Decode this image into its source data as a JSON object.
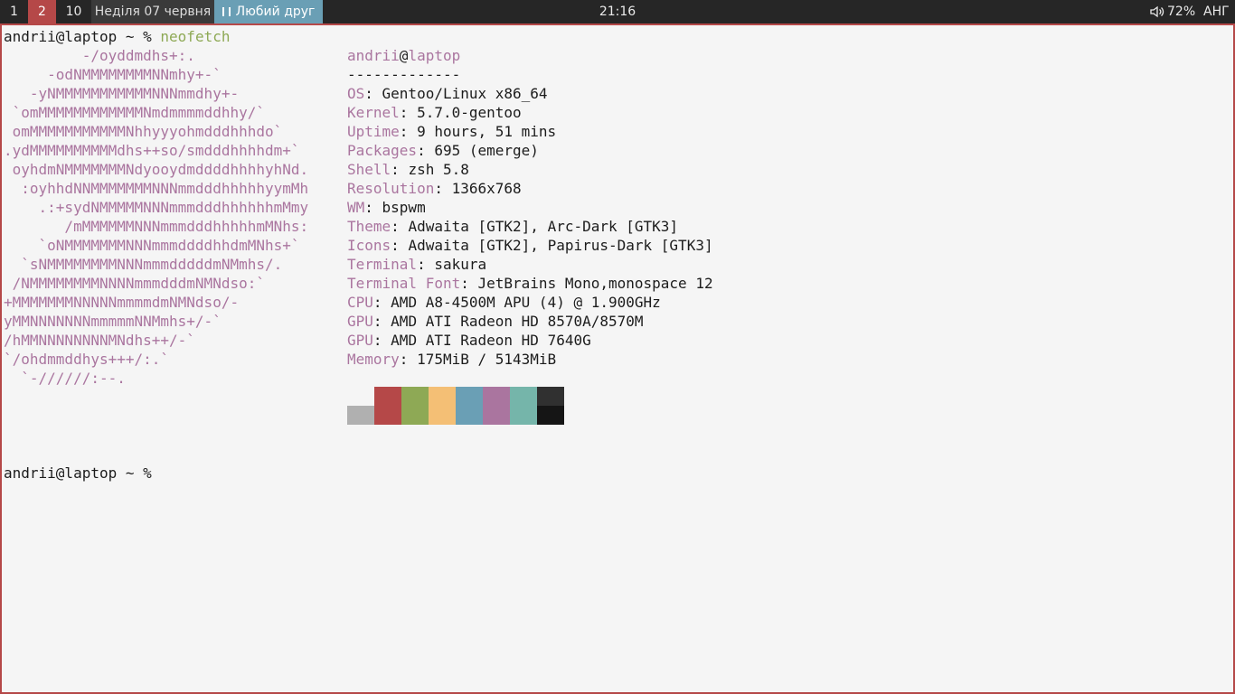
{
  "topbar": {
    "workspaces": [
      "1",
      "2",
      "10"
    ],
    "active_workspace": "2",
    "date": "Неділя 07 червня",
    "now_playing": "Любий друг",
    "clock": "21:16",
    "volume": "72%",
    "keyboard_layout": "АНГ"
  },
  "terminal": {
    "prompt": "andrii@laptop ~ %",
    "command": "neofetch",
    "logo_lines": [
      "         -/oyddmdhs+:.",
      "     -odNMMMMMMMMNNmhy+-`",
      "   -yNMMMMMMMMMMMNNNmmdhy+-",
      " `omMMMMMMMMMMMMNmdmmmmddhhy/`",
      " omMMMMMMMMMMMNhhyyyohmdddhhhdo`",
      ".ydMMMMMMMMMMdhs++so/smdddhhhhdm+`",
      " oyhdmNMMMMMMMNdyooydmddddhhhhyhNd.",
      "  :oyhhdNNMMMMMMMNNNmmdddhhhhhyymMh",
      "    .:+sydNMMMMMNNNmmmdddhhhhhhmMmy",
      "       /mMMMMMMNNNmmmdddhhhhhmMNhs:",
      "    `oNMMMMMMMNNNmmmddddhhdmMNhs+`",
      "  `sNMMMMMMMMNNNmmmdddddmNMmhs/.",
      " /NMMMMMMMMNNNNmmmdddmNMNdso:`",
      "+MMMMMMMNNNNNmmmmdmNMNdso/-",
      "yMMNNNNNNNmmmmmNNMmhs+/-`",
      "/hMMNNNNNNNNMNdhs++/-`",
      "`/ohdmmddhys+++/:.`",
      "  `-//////:--."
    ],
    "user": "andrii",
    "at": "@",
    "host": "laptop",
    "separator": "-------------",
    "info": [
      {
        "label": "OS",
        "value": "Gentoo/Linux x86_64"
      },
      {
        "label": "Kernel",
        "value": "5.7.0-gentoo"
      },
      {
        "label": "Uptime",
        "value": "9 hours, 51 mins"
      },
      {
        "label": "Packages",
        "value": "695 (emerge)"
      },
      {
        "label": "Shell",
        "value": "zsh 5.8"
      },
      {
        "label": "Resolution",
        "value": "1366x768"
      },
      {
        "label": "WM",
        "value": "bspwm"
      },
      {
        "label": "Theme",
        "value": "Adwaita [GTK2], Arc-Dark [GTK3]"
      },
      {
        "label": "Icons",
        "value": "Adwaita [GTK2], Papirus-Dark [GTK3]"
      },
      {
        "label": "Terminal",
        "value": "sakura"
      },
      {
        "label": "Terminal Font",
        "value": "JetBrains Mono,monospace 12"
      },
      {
        "label": "CPU",
        "value": "AMD A8-4500M APU (4) @ 1.900GHz"
      },
      {
        "label": "GPU",
        "value": "AMD ATI Radeon HD 8570A/8570M"
      },
      {
        "label": "GPU",
        "value": "AMD ATI Radeon HD 7640G"
      },
      {
        "label": "Memory",
        "value": "175MiB / 5143MiB"
      }
    ],
    "palette_top": [
      "#f5f5f5",
      "#b54848",
      "#8ea955",
      "#f4bf75",
      "#6a9fb5",
      "#aa759f",
      "#75b5aa",
      "#303030"
    ],
    "palette_bottom": [
      "#b0b0b0",
      "#b54848",
      "#8ea955",
      "#f4bf75",
      "#6a9fb5",
      "#aa759f",
      "#75b5aa",
      "#151515"
    ],
    "colors": {
      "label": "#aa759f",
      "command": "#8ea955",
      "text": "#1c1c1c",
      "border": "#b54848"
    }
  }
}
